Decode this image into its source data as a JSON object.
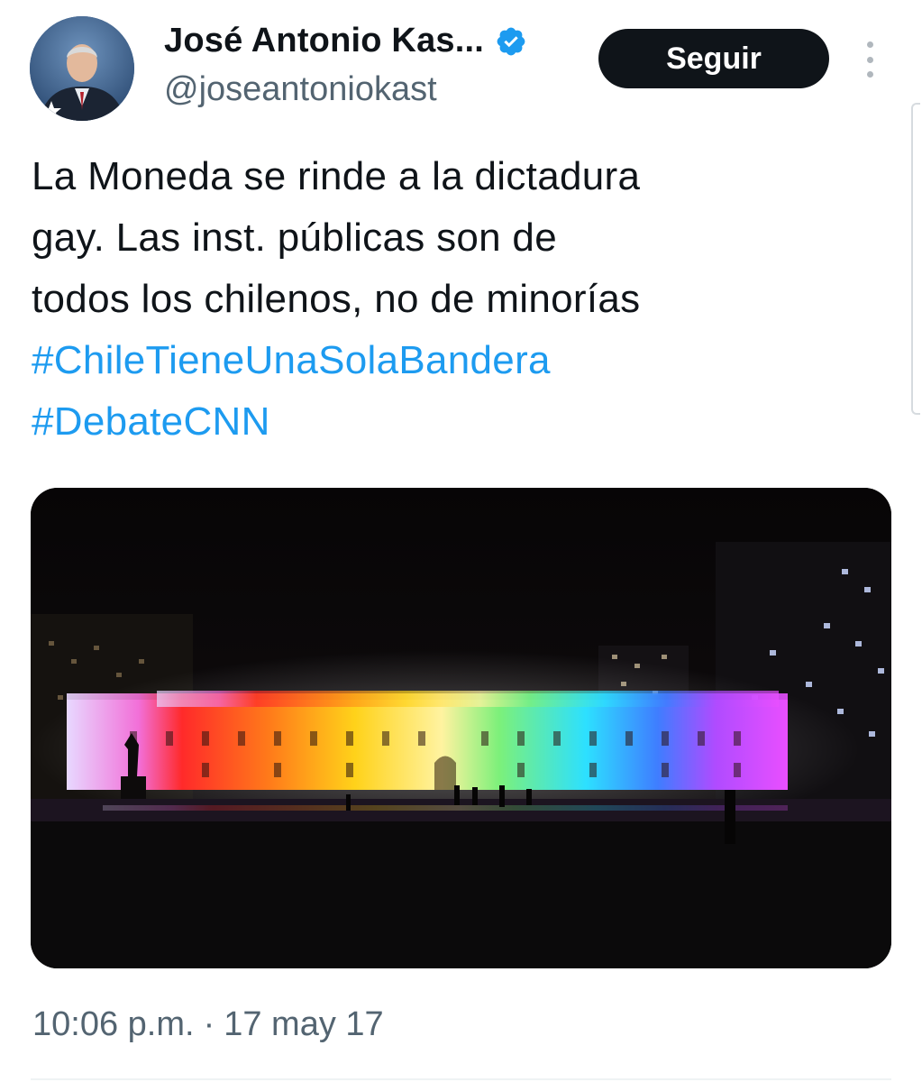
{
  "author": {
    "display_name": "José Antonio Kas...",
    "handle": "@joseantoniokast",
    "verified_icon": "verified-badge-icon",
    "avatar_icon": "profile-photo-avatar"
  },
  "header": {
    "follow_label": "Seguir",
    "more_icon": "more-vertical-icon"
  },
  "tweet": {
    "text_lines": [
      "La Moneda se rinde a la dictadura",
      "gay. Las inst. públicas son de",
      "todos los chilenos, no de minorías"
    ],
    "hashtags": [
      "#ChileTieneUnaSolaBandera",
      "#DebateCNN"
    ]
  },
  "media": {
    "kind": "photo"
  },
  "meta": {
    "time": "10:06 p.m.",
    "separator": "·",
    "date": "17 may 17"
  },
  "colors": {
    "text": "#0f1419",
    "secondary": "#536471",
    "link": "#1d9bf0",
    "button_bg": "#0f1419",
    "verified": "#1d9bf0"
  }
}
